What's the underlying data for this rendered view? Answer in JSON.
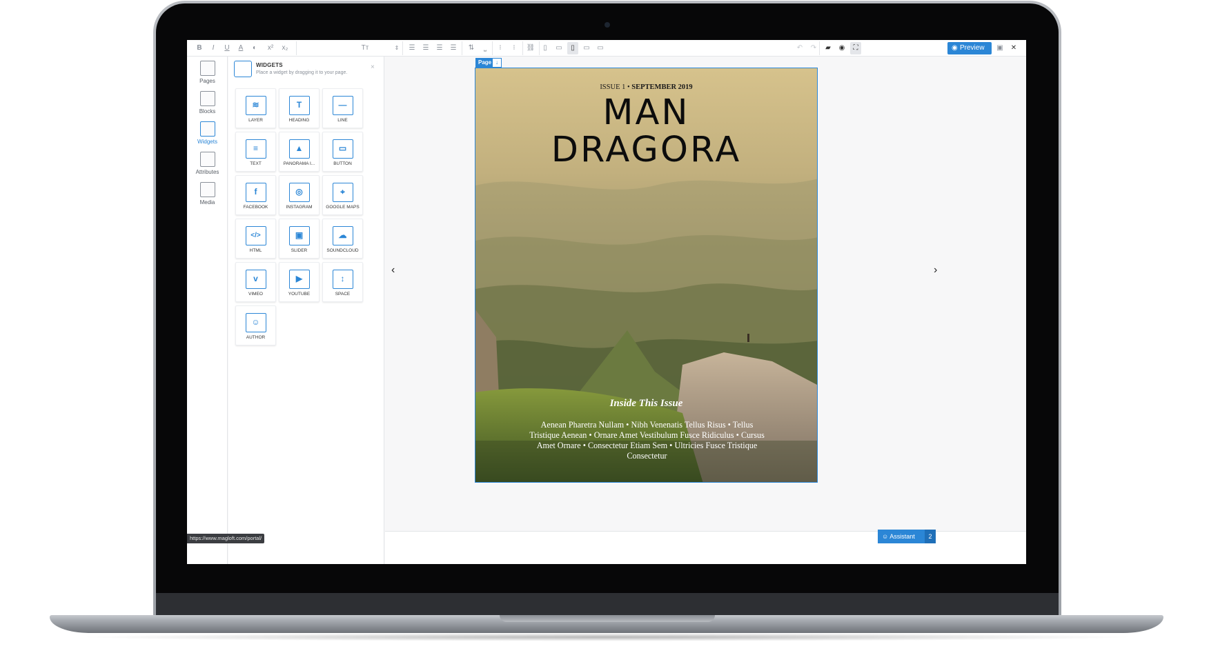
{
  "toolbar": {
    "format_buttons": [
      "B",
      "I",
      "U",
      "A",
      "◐",
      "x²",
      "x₂"
    ],
    "font_size_icon": "Tт",
    "align_icons": [
      "align-left-icon",
      "align-center-icon",
      "align-right-icon",
      "align-justify-icon"
    ],
    "list_icons": [
      "line-height-icon",
      "indent-icon",
      "numbered-list-icon",
      "bullet-list-icon"
    ],
    "link_icon": "link-icon",
    "device_icons": [
      "phone-portrait-icon",
      "phone-landscape-icon",
      "tablet-portrait-icon",
      "tablet-landscape-icon",
      "desktop-icon"
    ],
    "preview_label": "Preview",
    "accent_color": "#2b86d6"
  },
  "rail": {
    "items": [
      {
        "label": "Pages",
        "icon": "pages-icon"
      },
      {
        "label": "Blocks",
        "icon": "blocks-icon"
      },
      {
        "label": "Widgets",
        "icon": "widgets-icon",
        "selected": true
      },
      {
        "label": "Attributes",
        "icon": "attributes-icon"
      },
      {
        "label": "Media",
        "icon": "media-icon"
      }
    ]
  },
  "widgets_panel": {
    "title": "WIDGETS",
    "subtitle": "Place a widget by dragging it to your page.",
    "close": "×",
    "widgets": [
      {
        "label": "LAYER",
        "glyph": "≋"
      },
      {
        "label": "HEADING",
        "glyph": "T"
      },
      {
        "label": "LINE",
        "glyph": "—"
      },
      {
        "label": "TEXT",
        "glyph": "≡"
      },
      {
        "label": "PANORAMA I...",
        "glyph": "▲"
      },
      {
        "label": "BUTTON",
        "glyph": "▭"
      },
      {
        "label": "FACEBOOK",
        "glyph": "f"
      },
      {
        "label": "INSTAGRAM",
        "glyph": "◎"
      },
      {
        "label": "GOOGLE MAPS",
        "glyph": "⌖"
      },
      {
        "label": "HTML",
        "glyph": "</>"
      },
      {
        "label": "SLIDER",
        "glyph": "▣"
      },
      {
        "label": "SOUNDCLOUD",
        "glyph": "☁"
      },
      {
        "label": "VIMEO",
        "glyph": "v"
      },
      {
        "label": "YOUTUBE",
        "glyph": "▶"
      },
      {
        "label": "SPACE",
        "glyph": "↕"
      },
      {
        "label": "AUTHOR",
        "glyph": "☺"
      }
    ]
  },
  "canvas": {
    "page_tag": "Page",
    "page_tag_icon": "↓",
    "prev": "‹",
    "next": "›"
  },
  "magazine": {
    "issue_prefix": "ISSUE 1 • ",
    "issue_date": "SEPTEMBER 2019",
    "title_line1": "MAN",
    "title_line2": "DRAGORA",
    "inside_heading": "Inside This Issue",
    "articles": "Aenean Pharetra Nullam • Nibh Venenatis Tellus Risus • Tellus Tristique Aenean • Ornare Amet Vestibulum Fusce Ridiculus • Cursus Amet Ornare • Consectetur Etiam Sem • Ultricies Fusce Tristique Consectetur"
  },
  "status": {
    "assistant_label": "Assistant",
    "assistant_count": "2",
    "url_tooltip": "https://www.magloft.com/portal/"
  }
}
